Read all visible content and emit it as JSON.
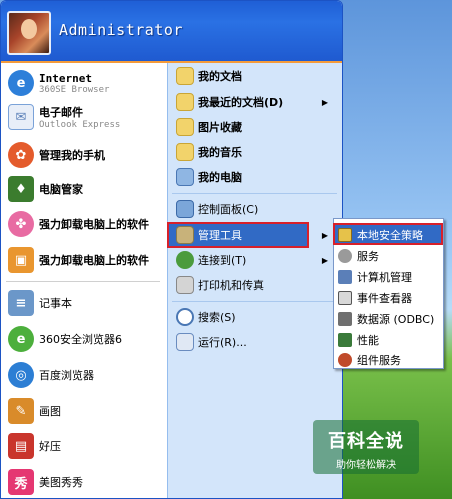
{
  "user": {
    "name": "Administrator"
  },
  "left_items": [
    {
      "label": "Internet",
      "sub": "360SE Browser",
      "icon": "browser-globe-icon",
      "color": "#2d7fd9"
    },
    {
      "label": "电子邮件",
      "sub": "Outlook Express",
      "icon": "email-icon",
      "color": "#7aa2d8"
    },
    {
      "label": "管理我的手机",
      "icon": "phone-manager-icon",
      "color": "#e45b2c"
    },
    {
      "label": "电脑管家",
      "icon": "shield-icon",
      "color": "#3b7c2e"
    },
    {
      "label": "强力卸载电脑上的软件",
      "icon": "uninstall-icon",
      "color": "#e86ba2"
    },
    {
      "label": "强力卸载电脑上的软件",
      "icon": "package-icon",
      "color": "#e9962f"
    },
    {
      "label": "记事本",
      "icon": "notepad-icon",
      "color": "#6b97c9"
    },
    {
      "label": "360安全浏览器6",
      "icon": "360-browser-icon",
      "color": "#4caf3c"
    },
    {
      "label": "百度浏览器",
      "icon": "baidu-browser-icon",
      "color": "#2c7ed4"
    },
    {
      "label": "画图",
      "icon": "paint-icon",
      "color": "#d98b2a"
    },
    {
      "label": "好压",
      "icon": "archive-icon",
      "color": "#c9352c"
    },
    {
      "label": "美图秀秀",
      "icon": "meitu-icon",
      "color": "#e53772"
    }
  ],
  "right_items": [
    {
      "label": "我的文档",
      "icon": "folder-icon"
    },
    {
      "label": "我最近的文档(D)",
      "icon": "recent-folder-icon",
      "has_submenu": true
    },
    {
      "label": "图片收藏",
      "icon": "pictures-folder-icon"
    },
    {
      "label": "我的音乐",
      "icon": "music-folder-icon"
    },
    {
      "label": "我的电脑",
      "icon": "computer-icon"
    },
    {
      "label": "控制面板(C)",
      "icon": "control-panel-icon"
    },
    {
      "label": "管理工具",
      "icon": "admin-tools-icon",
      "has_submenu": true,
      "highlighted": true
    },
    {
      "label": "连接到(T)",
      "icon": "network-icon",
      "has_submenu": true
    },
    {
      "label": "打印机和传真",
      "icon": "printer-icon"
    },
    {
      "label": "搜索(S)",
      "icon": "search-icon"
    },
    {
      "label": "运行(R)...",
      "icon": "run-icon"
    }
  ],
  "submenu_items": [
    {
      "label": "本地安全策略",
      "icon": "security-policy-icon",
      "highlighted": true
    },
    {
      "label": "服务",
      "icon": "services-gear-icon"
    },
    {
      "label": "计算机管理",
      "icon": "computer-management-icon"
    },
    {
      "label": "事件查看器",
      "icon": "event-viewer-icon"
    },
    {
      "label": "数据源 (ODBC)",
      "icon": "data-source-icon"
    },
    {
      "label": "性能",
      "icon": "performance-icon"
    },
    {
      "label": "组件服务",
      "icon": "component-services-icon"
    }
  ],
  "submenu_arrow": "▶",
  "watermark": {
    "title": "百科全说",
    "subtitle": "助你轻松解决"
  },
  "colors": {
    "header_blue": "#2a71e4",
    "highlight_blue": "#316ac5",
    "highlight_border": "#d8202a",
    "right_panel": "#d3e5fa",
    "header_accent": "#f49b3a"
  }
}
